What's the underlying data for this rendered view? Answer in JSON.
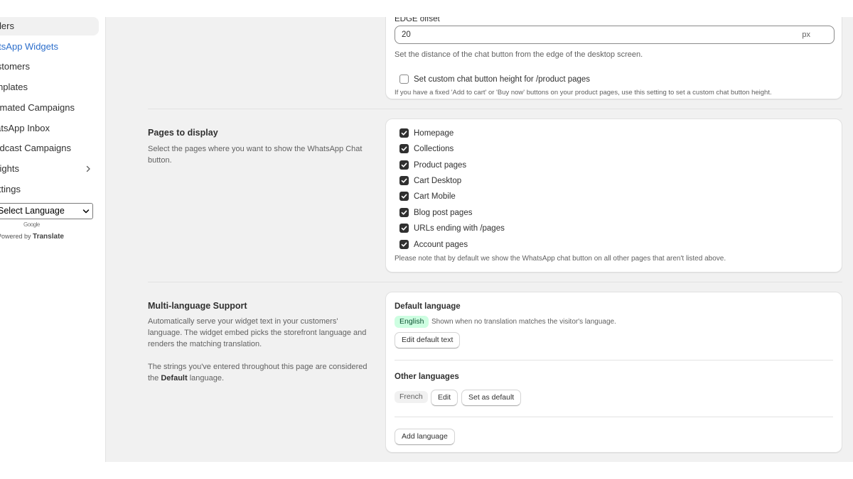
{
  "sidebar": {
    "items": [
      {
        "label": "Orders",
        "active": true
      },
      {
        "label": "WhatsApp Widgets",
        "link": true
      },
      {
        "label": "Customers"
      },
      {
        "label": "Templates"
      },
      {
        "label": "Automated Campaigns"
      },
      {
        "label": "WhatsApp Inbox"
      },
      {
        "label": "Broadcast Campaigns"
      },
      {
        "label": "Insights",
        "icon": "chevron-right-icon"
      },
      {
        "label": "Settings"
      }
    ],
    "language_select": {
      "value": "Select Language",
      "icon": "chevron-down-icon"
    },
    "google_logo": "Google",
    "powered_by": "Powered by",
    "translate": "Translate"
  },
  "edge_offset": {
    "label": "EDGE offset",
    "value": "20",
    "suffix": "px",
    "help": "Set the distance of the chat button from the edge of the desktop screen.",
    "custom_height_label": "Set custom chat button height for /product pages",
    "custom_height_checked": false,
    "custom_height_help": "If you have a fixed 'Add to cart' or 'Buy now' buttons on your product pages, use this setting to set a custom chat button height."
  },
  "pages_section": {
    "title": "Pages to display",
    "description": "Select the pages where you want to show the WhatsApp Chat button.",
    "pages": [
      {
        "label": "Homepage",
        "checked": true
      },
      {
        "label": "Collections",
        "checked": true
      },
      {
        "label": "Product pages",
        "checked": true
      },
      {
        "label": "Cart Desktop",
        "checked": true
      },
      {
        "label": "Cart Mobile",
        "checked": true
      },
      {
        "label": "Blog post pages",
        "checked": true
      },
      {
        "label": "URLs ending with /pages",
        "checked": true
      },
      {
        "label": "Account pages",
        "checked": true
      }
    ],
    "note": "Please note that by default we show the WhatsApp chat button on all other pages that aren't listed above."
  },
  "language_section": {
    "title": "Multi-language Support",
    "description1": "Automatically serve your widget text in your customers' language. The widget embed picks the storefront language and renders the matching translation.",
    "description2_prefix": "The strings you've entered throughout this page are considered the",
    "description2_bold": "Default",
    "description2_suffix": "language.",
    "default_language_heading": "Default language",
    "default_language": "English",
    "default_language_help": "Shown when no translation matches the visitor's language.",
    "edit_default_button": "Edit default text",
    "other_languages_heading": "Other languages",
    "other_language": "French",
    "edit_button": "Edit",
    "set_default_button": "Set as default",
    "add_language_button": "Add language"
  },
  "colors": {
    "accent_link": "#2c6ecb",
    "badge_green_bg": "#cdfee1",
    "checkbox_checked": "#303030",
    "page_bg": "#f1f1f1"
  }
}
